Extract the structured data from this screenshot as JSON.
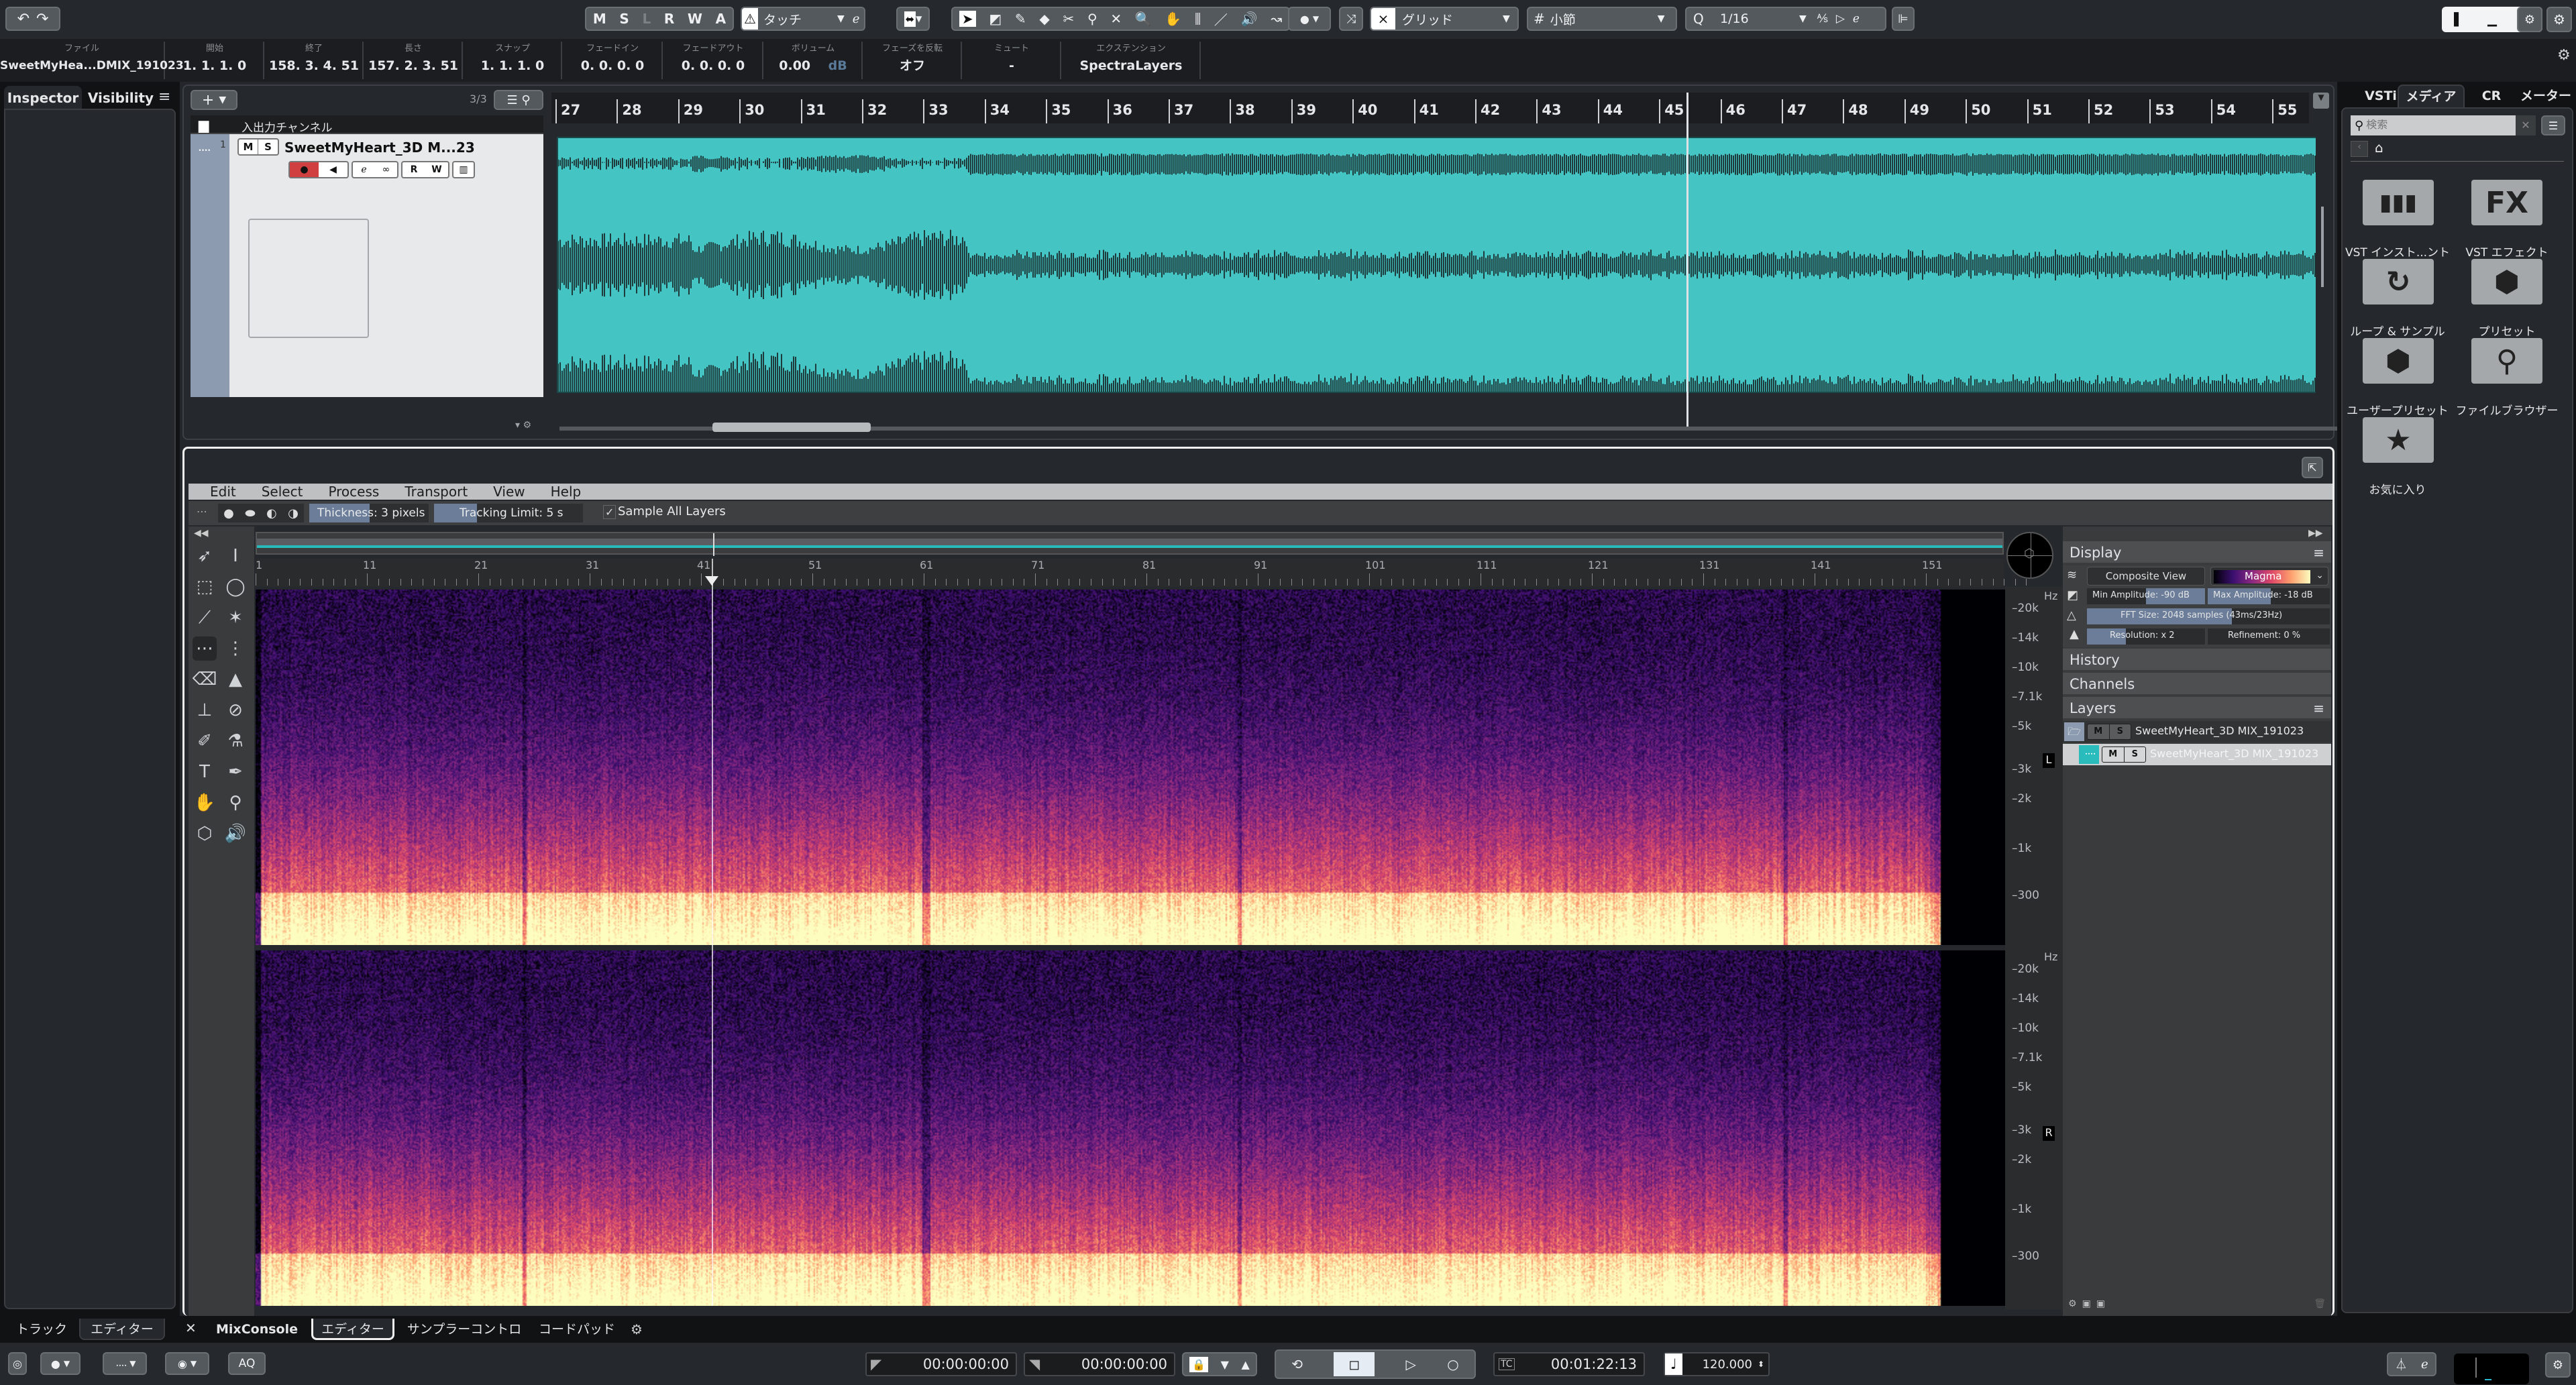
{
  "toolbar": {
    "undo_icon": "undo-icon",
    "redo_icon": "redo-icon",
    "automation_buttons": [
      "M",
      "S",
      "L",
      "R",
      "W",
      "A"
    ],
    "automation_mode": "タッチ",
    "snap_type": "グリッド",
    "grid_type": "小節",
    "quantize_label": "Q",
    "quantize_value": "1/16"
  },
  "infoline": {
    "columns": [
      {
        "label": "ファイル",
        "value": "SweetMyHea...DMIX_191023"
      },
      {
        "label": "開始",
        "value": "1. 1. 1.  0"
      },
      {
        "label": "終了",
        "value": "158. 3. 4. 51"
      },
      {
        "label": "長さ",
        "value": "157. 2. 3. 51"
      },
      {
        "label": "スナップ",
        "value": "1. 1. 1.  0"
      },
      {
        "label": "フェードイン",
        "value": "0. 0. 0.  0"
      },
      {
        "label": "フェードアウト",
        "value": "0. 0. 0.  0"
      },
      {
        "label": "ボリューム",
        "value": "0.00",
        "unit": "dB"
      },
      {
        "label": "フェーズを反転",
        "value": "オフ"
      },
      {
        "label": "ミュート",
        "value": "-"
      },
      {
        "label": "エクステンション",
        "value": "SpectraLayers"
      }
    ]
  },
  "inspector": {
    "tabs": [
      "Inspector",
      "Visibility"
    ]
  },
  "tracklist": {
    "count": "3/3",
    "folder_name": "入出力チャンネル",
    "track_number": "1",
    "track_name": "SweetMyHeart_3D M...23",
    "mute": "M",
    "solo": "S",
    "read": "R",
    "write": "W"
  },
  "ruler": {
    "bars": [
      "27",
      "28",
      "29",
      "30",
      "31",
      "32",
      "33",
      "34",
      "35",
      "36",
      "37",
      "38",
      "39",
      "40",
      "41",
      "42",
      "43",
      "44",
      "45",
      "46",
      "47",
      "48",
      "49",
      "50",
      "51",
      "52",
      "53",
      "54",
      "55"
    ]
  },
  "spectralayers": {
    "menu": [
      "Edit",
      "Select",
      "Process",
      "Transport",
      "View",
      "Help"
    ],
    "thickness": "Thickness: 3 pixels",
    "tracking_limit": "Tracking Limit: 5 s",
    "sample_all_layers": "Sample All Layers",
    "sample_all_checked": true,
    "timeline_labels": [
      "1",
      "11",
      "21",
      "31",
      "41",
      "51",
      "61",
      "71",
      "81",
      "91",
      "101",
      "111",
      "121",
      "131",
      "141",
      "151"
    ],
    "hz_unit": "Hz",
    "freq_labels": [
      "20k",
      "14k",
      "10k",
      "7.1k",
      "5k",
      "3k",
      "2k",
      "1k",
      "300"
    ],
    "channel_labels": [
      "L",
      "R"
    ],
    "display": {
      "title": "Display",
      "composite_view": "Composite View",
      "colormap": "Magma",
      "min_amplitude": "Min Amplitude: -90 dB",
      "max_amplitude": "Max Amplitude: -18 dB",
      "fft_size": "FFT Size: 2048 samples (43ms/23Hz)",
      "resolution": "Resolution: x 2",
      "refinement": "Refinement: 0 %"
    },
    "history_title": "History",
    "channels_title": "Channels",
    "layers_title": "Layers",
    "layers": [
      {
        "name": "SweetMyHeart_3D MIX_191023",
        "type": "folder",
        "m": "M",
        "s": "S"
      },
      {
        "name": "SweetMyHeart_3D MIX_191023",
        "type": "audio",
        "m": "M",
        "s": "S",
        "selected": true
      }
    ]
  },
  "media": {
    "tabs": [
      "VSTi",
      "メディア",
      "CR",
      "メーター"
    ],
    "active_tab": "メディア",
    "search_placeholder": "検索",
    "tiles": [
      {
        "icon": "piano-keys-icon",
        "label": "VST インスト...ント"
      },
      {
        "icon": "fx-icon",
        "label": "VST エフェクト"
      },
      {
        "icon": "loop-icon",
        "label": "ループ & サンプル"
      },
      {
        "icon": "presets-icon",
        "label": "プリセット"
      },
      {
        "icon": "user-presets-icon",
        "label": "ユーザープリセット"
      },
      {
        "icon": "file-browser-icon",
        "label": "ファイルブラウザー"
      },
      {
        "icon": "star-icon",
        "label": "お気に入り"
      }
    ]
  },
  "lower_zone": {
    "left_tabs": [
      "トラック",
      "エディター"
    ],
    "tabs": [
      "MixConsole",
      "エディター",
      "サンプラーコントロール",
      "コードパッド"
    ],
    "active_tab": "エディター"
  },
  "transport": {
    "aq_label": "AQ",
    "left_locator": "00:00:00:00",
    "right_locator": "00:00:00:00",
    "position": "00:01:22:13",
    "tempo": "120.000"
  }
}
